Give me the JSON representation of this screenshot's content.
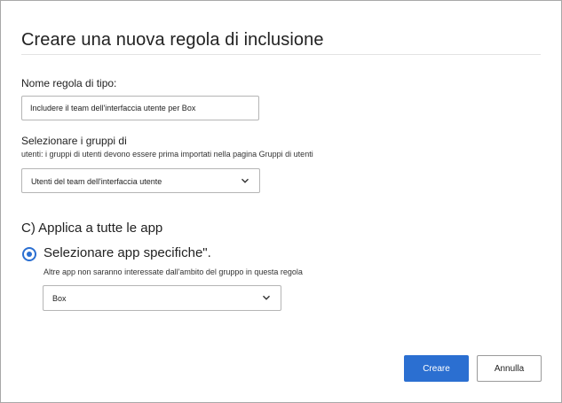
{
  "dialog": {
    "title": "Creare una nuova regola di inclusione"
  },
  "rule_name": {
    "label": "Nome regola di tipo:",
    "value": "Includere il team dell'interfaccia utente per Box"
  },
  "user_groups": {
    "label": "Selezionare i gruppi di",
    "hint": "utenti: i gruppi di utenti devono essere prima importati nella pagina Gruppi di utenti",
    "selected": "Utenti del team dell'interfaccia utente"
  },
  "apps": {
    "all_apps_label": "C) Applica a tutte le app",
    "specific_apps_label": "Selezionare app specifiche\".",
    "specific_hint": "Altre app non saranno interessate dall'ambito del gruppo in questa regola",
    "selected_app": "Box",
    "selected_option": "specific"
  },
  "actions": {
    "create_label": "Creare",
    "cancel_label": "Annulla"
  },
  "colors": {
    "accent": "#2b6fd1",
    "border": "#b5b5b5",
    "dialog_border": "#a8a8a8"
  },
  "icons": {
    "dropdown": "chevron-down-icon",
    "radio": "radio-checked-icon"
  }
}
